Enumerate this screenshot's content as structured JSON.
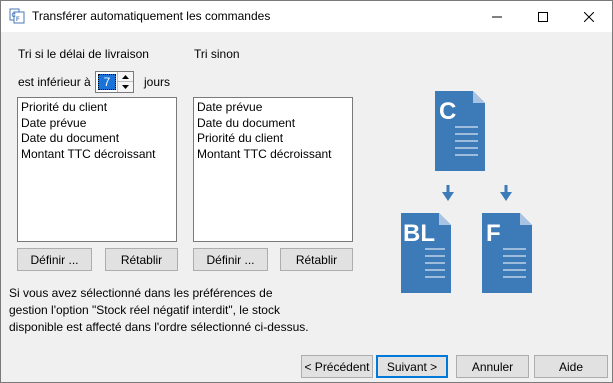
{
  "window": {
    "title": "Transférer automatiquement les commandes"
  },
  "left": {
    "label_line1": "Tri si le délai de livraison",
    "label_inferior": "est inférieur à",
    "days_value": "7",
    "days_unit": "jours",
    "items": [
      "Priorité du client",
      "Date prévue",
      "Date du document",
      "Montant TTC décroissant"
    ],
    "define_label": "Définir ...",
    "reset_label": "Rétablir"
  },
  "right": {
    "label": "Tri sinon",
    "items": [
      "Date prévue",
      "Date du document",
      "Priorité du client",
      "Montant TTC décroissant"
    ],
    "define_label": "Définir ...",
    "reset_label": "Rétablir"
  },
  "info_text": "Si vous avez sélectionné dans les préférences de gestion l'option \"Stock réel négatif interdit\", le stock disponible est affecté dans l'ordre sélectionné ci-dessus.",
  "diagram": {
    "doc_top": "C",
    "doc_left": "BL",
    "doc_right": "F",
    "color": "#3d7ab8"
  },
  "footer": {
    "previous_label": "< Précédent",
    "next_label": "Suivant >",
    "cancel_label": "Annuler",
    "help_label": "Aide"
  }
}
